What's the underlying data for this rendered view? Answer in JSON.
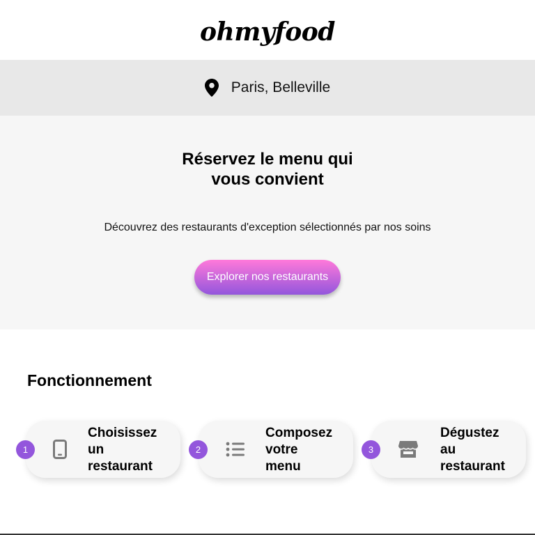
{
  "header": {
    "logo": "ohmyfood"
  },
  "location": {
    "text": "Paris, Belleville",
    "icon": "map-pin-icon"
  },
  "hero": {
    "title_line1": "Réservez le menu qui",
    "title_line2": "vous convient",
    "subtitle": "Découvrez des restaurants d'exception sélectionnés par nos soins",
    "cta_label": "Explorer nos restaurants"
  },
  "section": {
    "title": "Fonctionnement",
    "steps": [
      {
        "number": "1",
        "icon": "smartphone-icon",
        "line1": "Choisissez",
        "line2": "un",
        "line3": "restaurant"
      },
      {
        "number": "2",
        "icon": "list-icon",
        "line1": "Composez",
        "line2": "votre",
        "line3": "menu"
      },
      {
        "number": "3",
        "icon": "storefront-icon",
        "line1": "Dégustez",
        "line2": "au",
        "line3": "restaurant"
      }
    ]
  },
  "colors": {
    "accent": "#9356dc",
    "gradient_start": "#ff79da",
    "gradient_end": "#9356dc",
    "hero_bg": "#f6f6f6",
    "location_bg": "#e8e8e8"
  }
}
